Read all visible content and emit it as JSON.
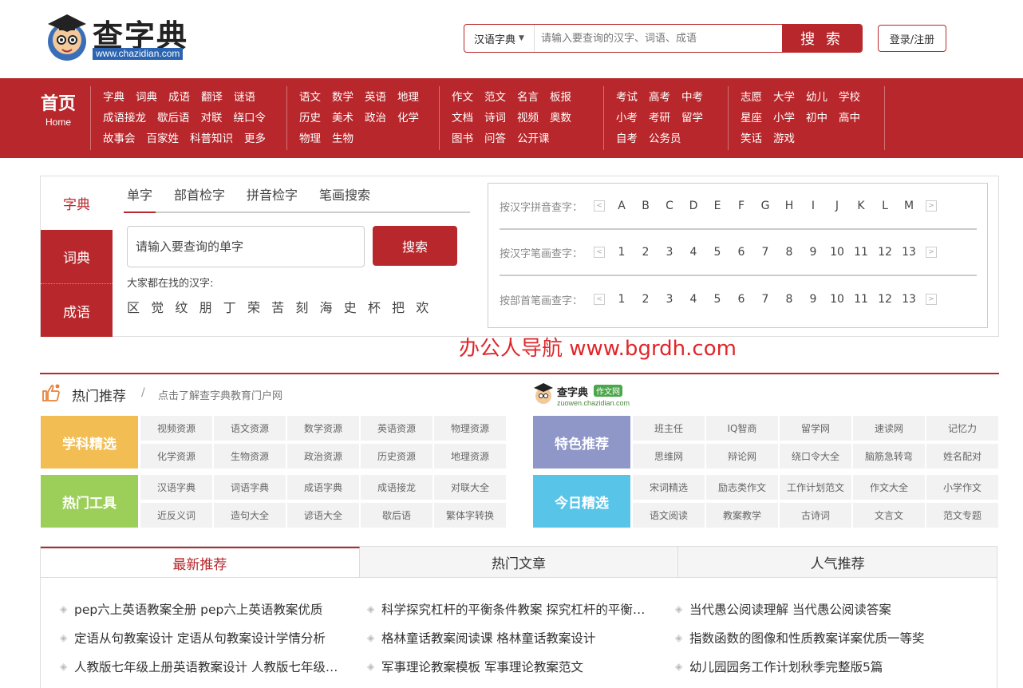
{
  "header": {
    "logo_title": "查字典",
    "logo_url": "www.chazidian.com",
    "search_select": "汉语字典",
    "search_placeholder": "请输入要查询的汉字、词语、成语",
    "search_button": "搜 索",
    "login_button": "登录/注册"
  },
  "nav": {
    "home": "首页",
    "home_en": "Home",
    "groups": [
      [
        [
          "字典",
          "词典",
          "成语",
          "翻译",
          "谜语"
        ],
        [
          "成语接龙",
          "歇后语",
          "对联",
          "绕口令"
        ],
        [
          "故事会",
          "百家姓",
          "科普知识",
          "更多"
        ]
      ],
      [
        [
          "语文",
          "数学",
          "英语",
          "地理"
        ],
        [
          "历史",
          "美术",
          "政治",
          "化学"
        ],
        [
          "物理",
          "生物"
        ]
      ],
      [
        [
          "作文",
          "范文",
          "名言",
          "板报"
        ],
        [
          "文档",
          "诗词",
          "视频",
          "奥数"
        ],
        [
          "图书",
          "问答",
          "公开课"
        ]
      ],
      [
        [
          "考试",
          "高考",
          "中考"
        ],
        [
          "小考",
          "考研",
          "留学"
        ],
        [
          "自考",
          "公务员"
        ]
      ],
      [
        [
          "志愿",
          "大学",
          "幼儿",
          "学校"
        ],
        [
          "星座",
          "小学",
          "初中",
          "高中"
        ],
        [
          "笑话",
          "游戏"
        ]
      ]
    ]
  },
  "dict": {
    "tabs": [
      "字典",
      "词典",
      "成语"
    ],
    "subtabs": [
      "单字",
      "部首检字",
      "拼音检字",
      "笔画搜索"
    ],
    "input_placeholder": "请输入要查询的单字",
    "search_button": "搜索",
    "hot_label": "大家都在找的汉字:",
    "hot_chars": [
      "区",
      "觉",
      "纹",
      "朋",
      "丁",
      "荣",
      "苦",
      "刻",
      "海",
      "史",
      "杯",
      "把",
      "欢"
    ],
    "lookup": [
      {
        "label": "按汉字拼音查字：",
        "items": [
          "A",
          "B",
          "C",
          "D",
          "E",
          "F",
          "G",
          "H",
          "I",
          "J",
          "K",
          "L",
          "M"
        ]
      },
      {
        "label": "按汉字笔画查字：",
        "items": [
          "1",
          "2",
          "3",
          "4",
          "5",
          "6",
          "7",
          "8",
          "9",
          "10",
          "11",
          "12",
          "13"
        ]
      },
      {
        "label": "按部首笔画查字：",
        "items": [
          "1",
          "2",
          "3",
          "4",
          "5",
          "6",
          "7",
          "8",
          "9",
          "10",
          "11",
          "12",
          "13"
        ]
      }
    ]
  },
  "watermark": "办公人导航  www.bgrdh.com",
  "recommend": {
    "title": "热门推荐",
    "slash": "/",
    "subtitle": "点击了解查字典教育门户网",
    "zw_logo_title": "查字典",
    "zw_logo_badge": "作文网",
    "zw_logo_url": "zuowen.chazidian.com",
    "left": [
      {
        "category": "学科精选",
        "color": "#f2bd52",
        "row1": [
          "视频资源",
          "语文资源",
          "数学资源",
          "英语资源",
          "物理资源"
        ],
        "row2": [
          "化学资源",
          "生物资源",
          "政治资源",
          "历史资源",
          "地理资源"
        ]
      },
      {
        "category": "热门工具",
        "color": "#9ccf5a",
        "row1": [
          "汉语字典",
          "词语字典",
          "成语字典",
          "成语接龙",
          "对联大全"
        ],
        "row2": [
          "近反义词",
          "造句大全",
          "谚语大全",
          "歇后语",
          "繁体字转换"
        ]
      }
    ],
    "right": [
      {
        "category": "特色推荐",
        "color": "#8e97c8",
        "row1": [
          "班主任",
          "IQ智商",
          "留学网",
          "速读网",
          "记忆力"
        ],
        "row2": [
          "思维网",
          "辩论网",
          "绕口令大全",
          "脑筋急转弯",
          "姓名配对"
        ]
      },
      {
        "category": "今日精选",
        "color": "#58c4e8",
        "row1": [
          "宋词精选",
          "励志类作文",
          "工作计划范文",
          "作文大全",
          "小学作文"
        ],
        "row2": [
          "语文阅读",
          "教案教学",
          "古诗词",
          "文言文",
          "范文专题"
        ]
      }
    ]
  },
  "articles": {
    "tabs": [
      "最新推荐",
      "热门文章",
      "人气推荐"
    ],
    "columns": [
      [
        "pep六上英语教案全册 pep六上英语教案优质",
        "定语从句教案设计 定语从句教案设计学情分析",
        "人教版七年级上册英语教案设计 人教版七年级…"
      ],
      [
        "科学探究杠杆的平衡条件教案 探究杠杆的平衡…",
        "格林童话教案阅读课 格林童话教案设计",
        "军事理论教案模板 军事理论教案范文"
      ],
      [
        "当代愚公阅读理解 当代愚公阅读答案",
        "指数函数的图像和性质教案详案优质一等奖",
        "幼儿园园务工作计划秋季完整版5篇"
      ]
    ]
  }
}
